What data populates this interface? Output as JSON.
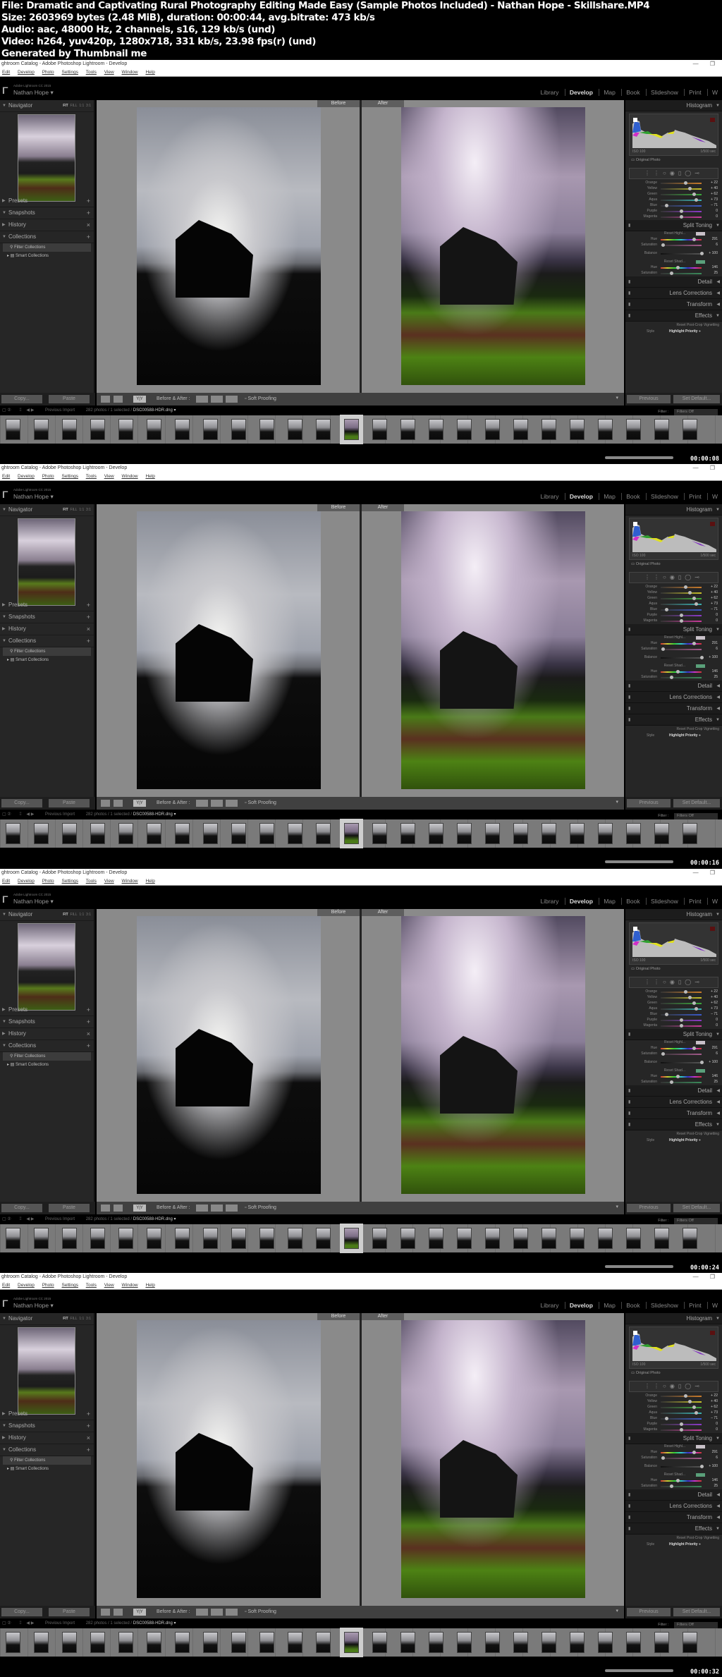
{
  "file_info": {
    "file": "File: Dramatic and Captivating Rural Photography Editing Made Easy (Sample Photos Included) - Nathan Hope - Skillshare.MP4",
    "size": "Size: 2603969 bytes (2.48 MiB), duration: 00:00:44, avg.bitrate: 473 kb/s",
    "audio": "Audio: aac, 48000 Hz, 2 channels, s16, 129 kb/s (und)",
    "video": "Video: h264, yuv420p, 1280x718, 331 kb/s, 23.98 fps(r) (und)",
    "generator": "Generated by Thumbnail me"
  },
  "window": {
    "title": "ghtroom Catalog - Adobe Photoshop Lightroom - Develop",
    "minimize": "—",
    "restore": "❐"
  },
  "menu": [
    "Edit",
    "Develop",
    "Photo",
    "Settings",
    "Tools",
    "View",
    "Window",
    "Help"
  ],
  "identity": {
    "logo": "Γ",
    "version": "Adobe Lightroom CC 2015",
    "user": "Nathan Hope ▾"
  },
  "modules": [
    "Library",
    "Develop",
    "Map",
    "Book",
    "Slideshow",
    "Print",
    "W"
  ],
  "active_module": "Develop",
  "left_panel": {
    "navigator": "Navigator",
    "nav_options": [
      "FIT",
      "FILL",
      "1:1",
      "3:1"
    ],
    "presets": "Presets",
    "snapshots": "Snapshots",
    "history": "History",
    "collections": "Collections",
    "filter_collections": "Filter Collections",
    "smart_collections": "Smart Collections",
    "copy": "Copy...",
    "paste": "Paste"
  },
  "compare": {
    "before": "Before",
    "after": "After"
  },
  "toolbar": {
    "yy": "Y|Y",
    "before_after": "Before & After :",
    "soft_proofing": "Soft Proofing"
  },
  "right_panel": {
    "histogram": "Histogram",
    "iso": "ISO 100",
    "shutter": "1/500 sec",
    "original_photo": "Original Photo",
    "hsl": [
      {
        "label": "Orange",
        "value": "+ 22",
        "pos": 0.61,
        "color": "#c87a2a"
      },
      {
        "label": "Yellow",
        "value": "+ 40",
        "pos": 0.7,
        "color": "#c8c02a"
      },
      {
        "label": "Green",
        "value": "+ 62",
        "pos": 0.81,
        "color": "#3aa83a"
      },
      {
        "label": "Aqua",
        "value": "+ 73",
        "pos": 0.86,
        "color": "#3ab0b0"
      },
      {
        "label": "Blue",
        "value": "– 71",
        "pos": 0.14,
        "color": "#3a5ac8"
      },
      {
        "label": "Purple",
        "value": "0",
        "pos": 0.5,
        "color": "#8a3ac8"
      },
      {
        "label": "Magenta",
        "value": "0",
        "pos": 0.5,
        "color": "#c83a9a"
      }
    ],
    "split_toning": "Split Toning",
    "highlights": {
      "reset": "Reset Highl...",
      "hue_label": "Hue",
      "hue": "291",
      "hue_pos": 0.81,
      "sat_label": "Saturation",
      "sat": "6",
      "sat_pos": 0.06,
      "swatch": "#c8c0c8"
    },
    "balance": {
      "label": "Balance",
      "value": "+ 100",
      "pos": 1.0
    },
    "shadows": {
      "reset": "Reset Shad...",
      "hue_label": "Hue",
      "hue": "146",
      "hue_pos": 0.41,
      "sat_label": "Saturation",
      "sat": "25",
      "sat_pos": 0.25,
      "swatch": "#5aa07a"
    },
    "detail": "Detail",
    "lens_corrections": "Lens Corrections",
    "transform": "Transform",
    "effects": "Effects",
    "vignette_reset": "Reset Post-Crop Vignetting",
    "style_label": "Style",
    "style_value": "Highlight Priority ÷",
    "previous": "Previous",
    "set_default": "Set Default..."
  },
  "filmstrip": {
    "source": "Previous Import",
    "count": "282 photos / 1 selected /",
    "filename": "DSC00588-HDR.dng ▾",
    "filter_label": "Filter :",
    "filter_value": "Filters Off"
  },
  "frames": [
    {
      "timecode": "00:00:08"
    },
    {
      "timecode": "00:00:16"
    },
    {
      "timecode": "00:00:24"
    },
    {
      "timecode": "00:00:32"
    }
  ]
}
